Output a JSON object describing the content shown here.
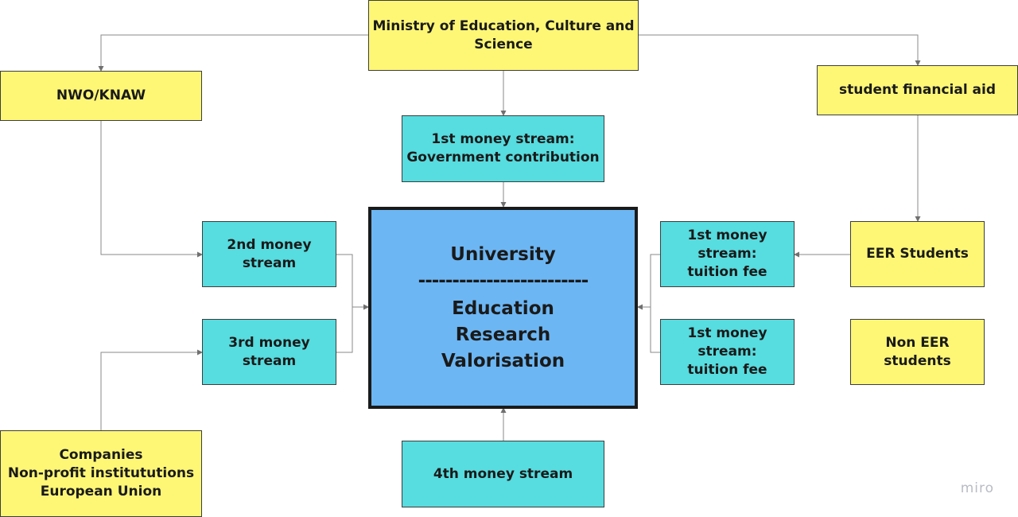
{
  "nodes": {
    "ministry": "Ministry of Education, Culture and Science",
    "nwo": "NWO/KNAW",
    "student_aid": "student financial aid",
    "first_stream_gov": "1st money stream:\nGovernment contribution",
    "second_stream": "2nd money stream",
    "third_stream": "3rd money stream",
    "tuition_fee_1": "1st money stream:\ntuition fee",
    "tuition_fee_2": "1st money stream:\ntuition fee",
    "eer_students": "EER Students",
    "non_eer_students": "Non EER students",
    "fourth_stream": "4th money stream",
    "companies": "Companies\nNon-profit institututions\nEuropean Union"
  },
  "university": {
    "title": "University",
    "divider": "-------------------------",
    "roles": [
      "Education",
      "Research",
      "Valorisation"
    ]
  },
  "watermark": "miro",
  "colors": {
    "yellow_box": "#fef776",
    "cyan_box": "#57dcdf",
    "university_box": "#6cb6f3",
    "connector": "#8a8a8a"
  }
}
